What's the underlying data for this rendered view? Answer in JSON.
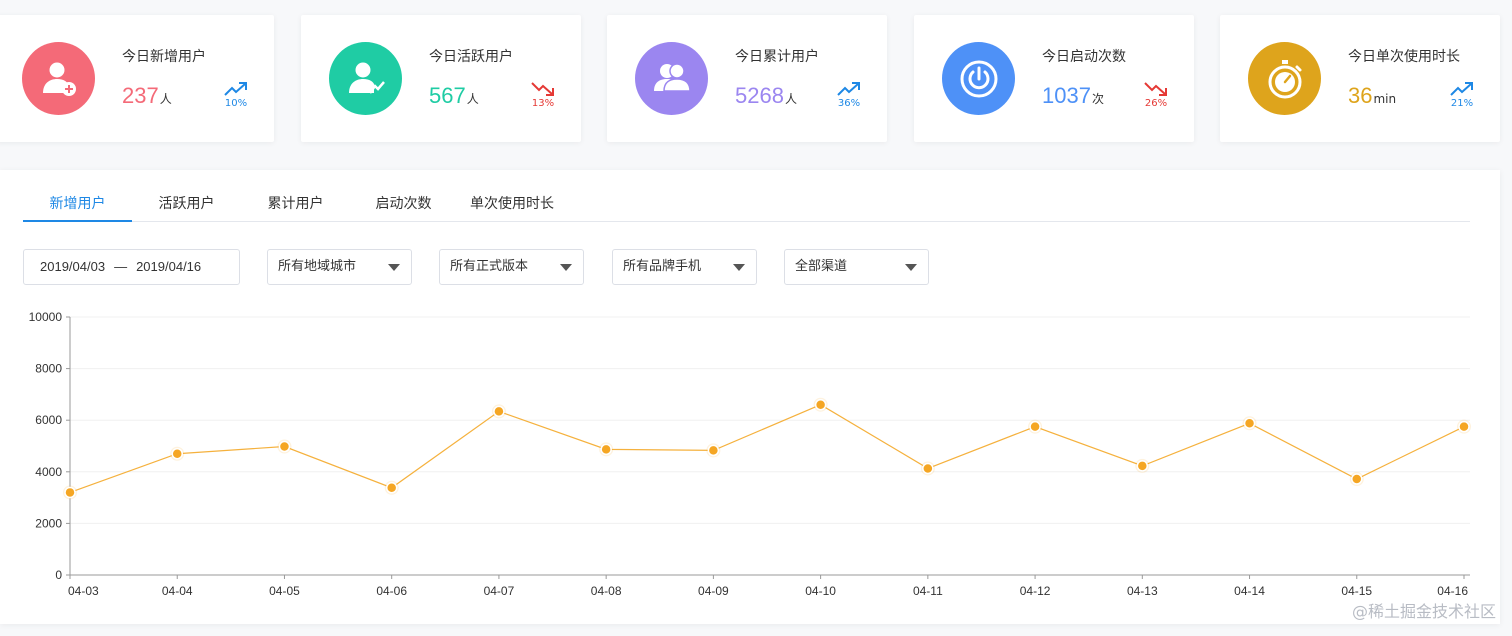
{
  "stats": [
    {
      "title": "今日新增用户",
      "value": "237",
      "unit": "人",
      "trend": "up",
      "pct": "10%",
      "color": "#f46a78",
      "icon": "add-user-icon"
    },
    {
      "title": "今日活跃用户",
      "value": "567",
      "unit": "人",
      "trend": "down",
      "pct": "13%",
      "color": "#1fcca4",
      "icon": "active-user-icon"
    },
    {
      "title": "今日累计用户",
      "value": "5268",
      "unit": "人",
      "trend": "up",
      "pct": "36%",
      "color": "#9b86f0",
      "icon": "users-icon"
    },
    {
      "title": "今日启动次数",
      "value": "1037",
      "unit": "次",
      "trend": "down",
      "pct": "26%",
      "color": "#4e91f7",
      "icon": "power-icon"
    },
    {
      "title": "今日单次使用时长",
      "value": "36",
      "unit": "min",
      "trend": "up",
      "pct": "21%",
      "color": "#dea41c",
      "icon": "stopwatch-icon"
    }
  ],
  "tabs": [
    "新增用户",
    "活跃用户",
    "累计用户",
    "启动次数",
    "单次使用时长"
  ],
  "active_tab": 0,
  "filters": {
    "date_start": "2019/04/03",
    "date_sep": "—",
    "date_end": "2019/04/16",
    "region": "所有地域城市",
    "version": "所有正式版本",
    "brand": "所有品牌手机",
    "channel": "全部渠道"
  },
  "chart_data": {
    "type": "line",
    "categories": [
      "04-03",
      "04-04",
      "04-05",
      "04-06",
      "04-07",
      "04-08",
      "04-09",
      "04-10",
      "04-11",
      "04-12",
      "04-13",
      "04-14",
      "04-15",
      "04-16"
    ],
    "values": [
      3200,
      4700,
      4980,
      3380,
      6340,
      4870,
      4830,
      6600,
      4130,
      5750,
      4230,
      5880,
      3720,
      5750
    ],
    "ylim": [
      0,
      10000
    ],
    "yticks": [
      0,
      2000,
      4000,
      6000,
      8000,
      10000
    ],
    "grid": true,
    "line_color": "#f5b13d",
    "point_color": "#f5a623"
  },
  "watermark": "@稀土掘金技术社区"
}
